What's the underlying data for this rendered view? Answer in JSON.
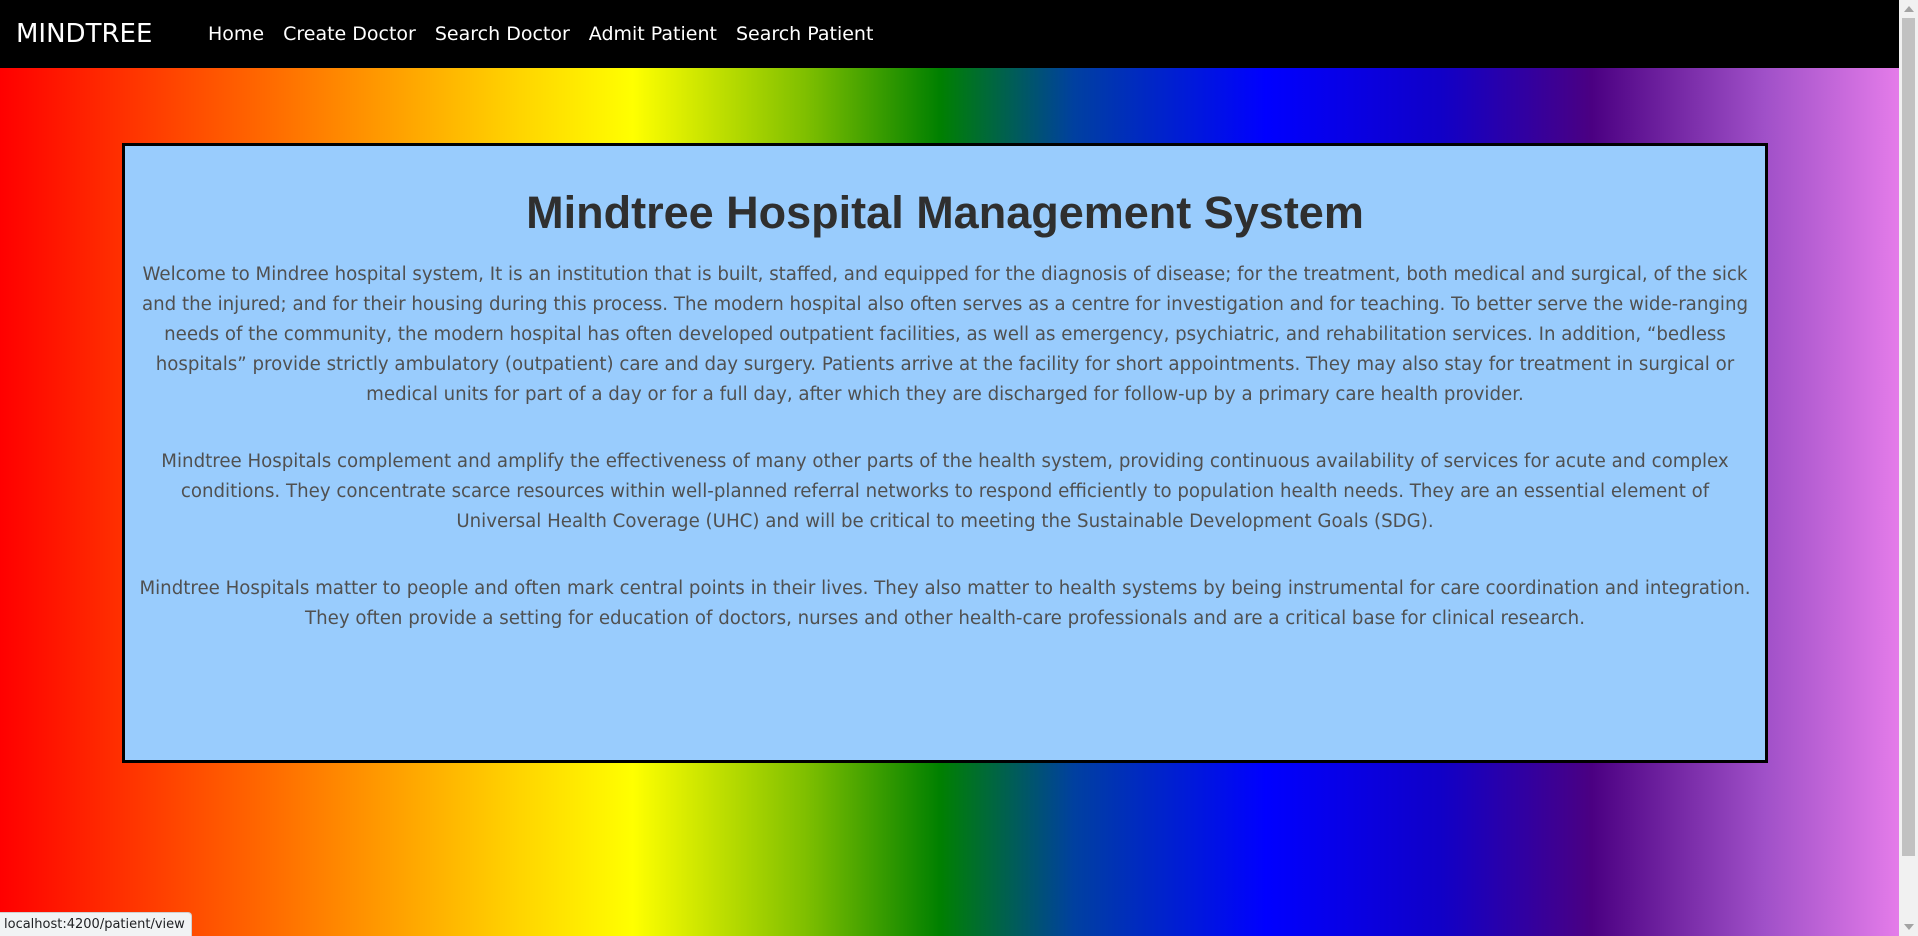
{
  "nav": {
    "brand": "MINDTREE",
    "links": [
      "Home",
      "Create Doctor",
      "Search Doctor",
      "Admit Patient",
      "Search Patient"
    ]
  },
  "main": {
    "title": "Mindtree Hospital Management System",
    "paragraphs": [
      "Welcome to Mindree hospital system, It is an institution that is built, staffed, and equipped for the diagnosis of disease; for the treatment, both medical and surgical, of the sick and the injured; and for their housing during this process. The modern hospital also often serves as a centre for investigation and for teaching. To better serve the wide-ranging needs of the community, the modern hospital has often developed outpatient facilities, as well as emergency, psychiatric, and rehabilitation services. In addition, “bedless hospitals” provide strictly ambulatory (outpatient) care and day surgery. Patients arrive at the facility for short appointments. They may also stay for treatment in surgical or medical units for part of a day or for a full day, after which they are discharged for follow-up by a primary care health provider.",
      "Mindtree Hospitals complement and amplify the effectiveness of many other parts of the health system, providing continuous availability of services for acute and complex conditions. They concentrate scarce resources within well-planned referral networks to respond efficiently to population health needs. They are an essential element of Universal Health Coverage (UHC) and will be critical to meeting the Sustainable Development Goals (SDG).",
      "Mindtree Hospitals matter to people and often mark central points in their lives. They also matter to health systems by being instrumental for care coordination and integration. They often provide a setting for education of doctors, nurses and other health-care professionals and are a critical base for clinical research."
    ]
  },
  "status_bar": {
    "url": "localhost:4200/patient/view"
  },
  "colors": {
    "navbar_bg": "#000000",
    "card_bg": "#99ccfd",
    "card_border": "#000000",
    "title_color": "#2f2f2f",
    "text_color": "#505050"
  }
}
